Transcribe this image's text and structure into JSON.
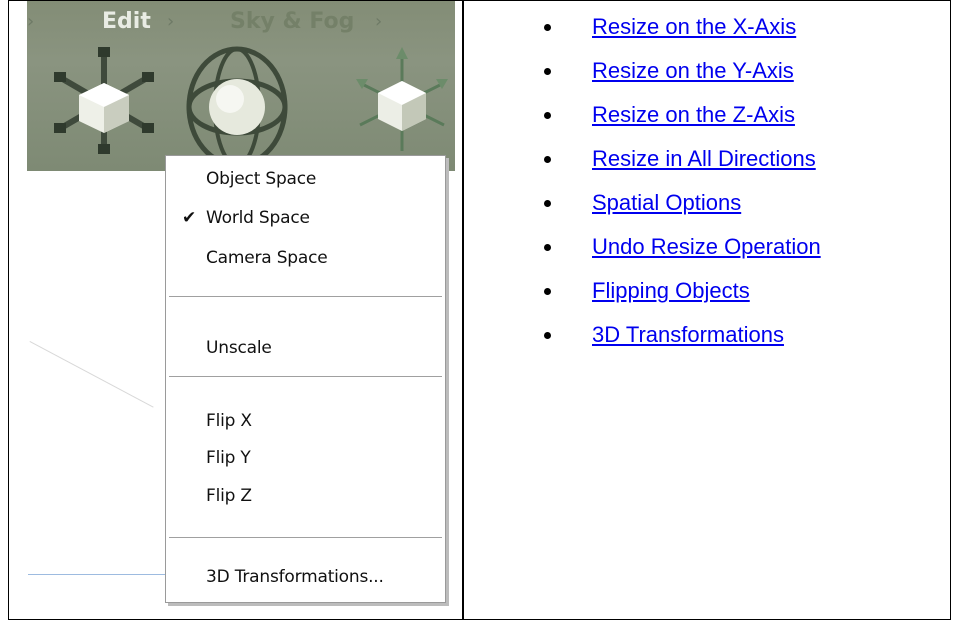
{
  "toolbar": {
    "edit_label": "Edit",
    "sky_fog_label": "Sky & Fog",
    "tool_icons": [
      "scale-axes-icon",
      "rotate-gyro-icon",
      "scale-cube-arrows-icon"
    ]
  },
  "context_menu": {
    "items": [
      {
        "label": "Object Space",
        "checked": false
      },
      {
        "label": "World Space",
        "checked": true
      },
      {
        "label": "Camera Space",
        "checked": false
      },
      {
        "label": "Unscale"
      },
      {
        "label": "Flip X"
      },
      {
        "label": "Flip Y"
      },
      {
        "label": "Flip Z"
      },
      {
        "label": "3D Transformations..."
      }
    ],
    "check_glyph": "✔"
  },
  "links": [
    "Resize on the X-Axis",
    "Resize on the Y-Axis",
    "Resize on the Z-Axis",
    "Resize in All Directions",
    "Spatial Options",
    "Undo Resize Operation",
    "Flipping Objects",
    "3D Transformations"
  ],
  "colors": {
    "link": "#0000ee",
    "toolbar_bg": "#848e78",
    "menu_bg": "#ffffff"
  }
}
